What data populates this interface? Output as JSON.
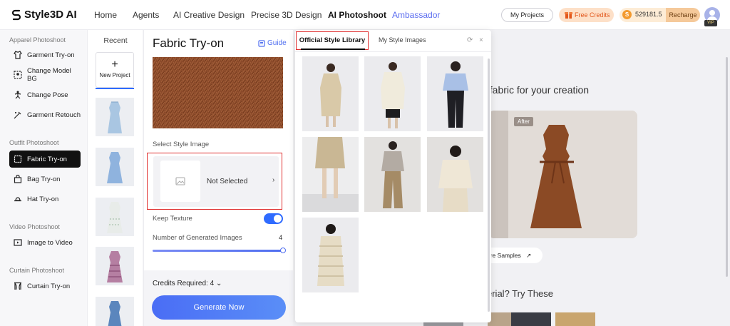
{
  "brand": {
    "name": "Style3D AI"
  },
  "nav": {
    "items": [
      "Home",
      "Agents",
      "AI Creative Design",
      "Precise 3D Design",
      "AI Photoshoot",
      "Ambassador"
    ],
    "my_projects": "My Projects",
    "free_credits": "Free Credits",
    "credit_balance": "529181.5",
    "recharge": "Recharge",
    "vip": "VIP"
  },
  "sidebar": {
    "sections": [
      {
        "title": "Apparel Photoshoot",
        "items": [
          "Garment Try-on",
          "Change Model BG",
          "Change Pose",
          "Garment Retouch"
        ]
      },
      {
        "title": "Outfit Photoshoot",
        "items": [
          "Fabric Try-on",
          "Bag Try-on",
          "Hat Try-on"
        ]
      },
      {
        "title": "Video Photoshoot",
        "items": [
          "Image to Video"
        ]
      },
      {
        "title": "Curtain Photoshoot",
        "items": [
          "Curtain Try-on"
        ]
      }
    ],
    "active": "Fabric Try-on"
  },
  "recent": {
    "title": "Recent",
    "new_project": "New Project",
    "plus": "+"
  },
  "panel": {
    "title": "Fabric Try-on",
    "guide": "Guide",
    "select_style_label": "Select Style Image",
    "not_selected": "Not Selected",
    "chevron": "›",
    "keep_texture_label": "Keep Texture",
    "keep_texture_on": true,
    "num_images_label": "Number of Generated Images",
    "num_images_value": "4",
    "credits_required": "Credits Required: 4",
    "credits_chevron": "⌄",
    "generate": "Generate Now"
  },
  "library": {
    "tab_official": "Official Style Library",
    "tab_my": "My Style Images",
    "refresh_icon": "⟳",
    "close_icon": "×",
    "tiles": 7
  },
  "main": {
    "heading_partial": "t fabric for your creation",
    "after_badge": "After",
    "more_samples": "ore Samples",
    "more_arrow": "↗",
    "heading2_partial": "erial? Try These"
  }
}
